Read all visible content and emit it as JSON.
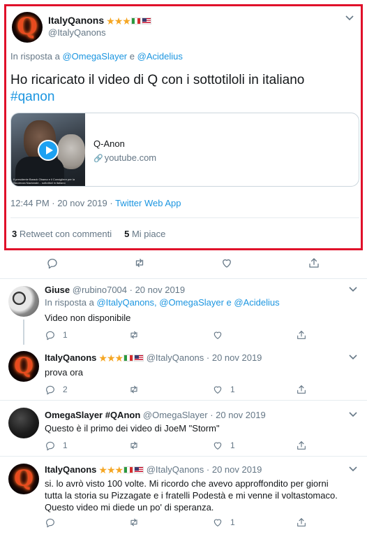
{
  "main_tweet": {
    "author_name": "ItalyQanons",
    "author_handle": "@ItalyQanons",
    "stars": "★★★",
    "reply_prefix": "In risposta a",
    "reply_user1": "@OmegaSlayer",
    "reply_conj": "e",
    "reply_user2": "@Acidelius",
    "text": "Ho ricaricato il video di Q con i sottotiloli in italiano",
    "hashtag": "#qanon",
    "card": {
      "title": "Q-Anon",
      "domain": "youtube.com",
      "thumb_caption": "Il presidente Barack Obama e il Consigliere per la Sicurezza Nazionale... sottotitoli in italiano"
    },
    "timestamp": "12:44 PM · 20 nov 2019 · ",
    "source": "Twitter Web App",
    "retweets_count": "3",
    "retweets_label": "Retweet con commenti",
    "likes_count": "5",
    "likes_label": "Mi piace"
  },
  "replies": [
    {
      "name": "Giuse",
      "handle": "@rubino7004",
      "date": " · 20 nov 2019",
      "reply_prefix": "In risposta a",
      "reply_users": "@ItalyQanons, @OmegaSlayer e @Acidelius",
      "text": "Video non disponibile",
      "reply_count": "1",
      "retweet_count": "",
      "like_count": ""
    },
    {
      "name": "ItalyQanons",
      "stars": "★★★",
      "handle": "@ItalyQanons",
      "date": " · 20 nov 2019",
      "text": "prova ora",
      "reply_count": "2",
      "retweet_count": "",
      "like_count": "1"
    },
    {
      "name": "OmegaSlayer #QAnon",
      "handle": "@OmegaSlayer",
      "date": " · 20 nov 2019",
      "text": "Questo è il primo dei video di JoeM \"Storm\"",
      "reply_count": "1",
      "retweet_count": "",
      "like_count": "1"
    },
    {
      "name": "ItalyQanons",
      "stars": "★★★",
      "handle": "@ItalyQanons",
      "date": " · 20 nov 2019",
      "text_line1": "si. lo avrò visto 100 volte. Mi ricordo che avevo approffondito per giorni",
      "text_line2": "tutta la storia su Pizzagate e i fratelli Podestà e mi venne il voltastomaco.",
      "text_line3": "Questo video mi diede un po' di speranza.",
      "reply_count": "",
      "retweet_count": "",
      "like_count": "1"
    }
  ],
  "icons": {
    "reply": "reply-icon",
    "retweet": "retweet-icon",
    "like": "heart-icon",
    "share": "share-icon",
    "chevron": "chevron-down-icon",
    "link": "link-icon",
    "play": "play-icon"
  },
  "colors": {
    "accent": "#1b95e0",
    "highlight_border": "#e0102a",
    "muted": "#657786"
  }
}
